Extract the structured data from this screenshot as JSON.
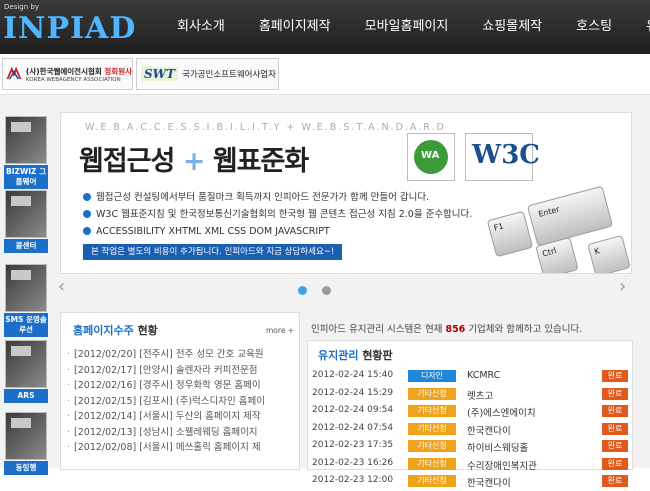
{
  "header": {
    "logo_small": "Design by",
    "logo": "INPIAD",
    "nav": [
      "회사소개",
      "홈페이지제작",
      "모바일홈페이지",
      "쇼핑몰제작",
      "호스팅",
      "유지"
    ]
  },
  "partners": {
    "kwa_line1_a": "(사)한국웹에이전시협회",
    "kwa_line1_b": " 정회원사",
    "kwa_line2": "KOREA WEBAGENCY ASSOCIATION",
    "swt_logo": "SWT",
    "swt_text": "국가공인소프트웨어사업자"
  },
  "sidebar": [
    {
      "label": "BIZWIZ 그룹웨어"
    },
    {
      "label": "콜센터"
    },
    {
      "label": "SMS 운영솔루션"
    },
    {
      "label": "ARS"
    },
    {
      "label": "동링행"
    }
  ],
  "banner": {
    "sub": "W.E.B.A.C.C.E.S.S.I.B.I.L.I.T.Y + W.E.B.S.T.A.N.D.A.R.D",
    "title_a": "웹접근성",
    "title_plus": "+",
    "title_b": "웹표준화",
    "w3c": "W3C",
    "bullets": [
      "웹접근성 컨설팅에서부터 품질마크 획득까지 인피아드 전문가가 함께 만들어 갑니다.",
      "W3C 웹표준지침 및 한국정보통신기술협회의 한국형 웹 콘텐츠 접근성 지침 2.0을 준수합니다.",
      "ACCESSIBILITY  XHTML  XML CSS DOM JAVASCRIPT"
    ],
    "cta": "본 작업은 별도의 비용이 추가됩니다. 인피아드와 지금 상담하세요~!",
    "keys": [
      "F1",
      "Enter",
      "Ctrl",
      "K"
    ],
    "arrow_left": "‹",
    "arrow_right": "›",
    "active_dot_color": "#3ea6e8",
    "inactive_dot_color": "#9a9a9a"
  },
  "orders": {
    "title_a": "홈페이지수주",
    "title_b": " 현황",
    "more": "more +",
    "items": [
      "[2012/02/20] [전주시] 전주 성모 간호 교육원",
      "[2012/02/17] [안양시] 솔렌자라 커피전문점",
      "[2012/02/16] [경주시] 정우화학 영문 홈페이",
      "[2012/02/15] [김포시] (주)럭스디자인 홈페이",
      "[2012/02/14] [서울시] 두산의 홈페이지 제작",
      "[2012/02/13] [성남시] 소웰레웨딩 홈페이지",
      "[2012/02/08] [서울시] 메쓰홀릭 홈페이지 제"
    ]
  },
  "info": {
    "before": "인피아드 유지관리 시스템은 현재 ",
    "count": "856",
    "after": " 기업체와 함께하고 있습니다."
  },
  "maintenance": {
    "title_a": "유지관리",
    "title_b": " 현황판",
    "rows": [
      {
        "date": "2012-02-24 15:40",
        "tag": "디자인",
        "tag_color": "#1f86d8",
        "name": "KCMRC",
        "status": "완료"
      },
      {
        "date": "2012-02-24 15:29",
        "tag": "기타신청",
        "tag_color": "#f0a21a",
        "name": "렛츠고",
        "status": "완료"
      },
      {
        "date": "2012-02-24 09:54",
        "tag": "기타신청",
        "tag_color": "#f0a21a",
        "name": "(주)에스엔에이치",
        "status": "완료"
      },
      {
        "date": "2012-02-24 07:54",
        "tag": "기타신청",
        "tag_color": "#f0a21a",
        "name": "한국캔다이",
        "status": "완료"
      },
      {
        "date": "2012-02-23 17:35",
        "tag": "기타신청",
        "tag_color": "#f0a21a",
        "name": "하이비스웨딩홀",
        "status": "완료"
      },
      {
        "date": "2012-02-23 16:26",
        "tag": "기타신청",
        "tag_color": "#f0a21a",
        "name": "수리장애인복지관",
        "status": "완료"
      },
      {
        "date": "2012-02-23 12:00",
        "tag": "기타신청",
        "tag_color": "#f0a21a",
        "name": "한국캔다이",
        "status": "완료"
      }
    ]
  }
}
